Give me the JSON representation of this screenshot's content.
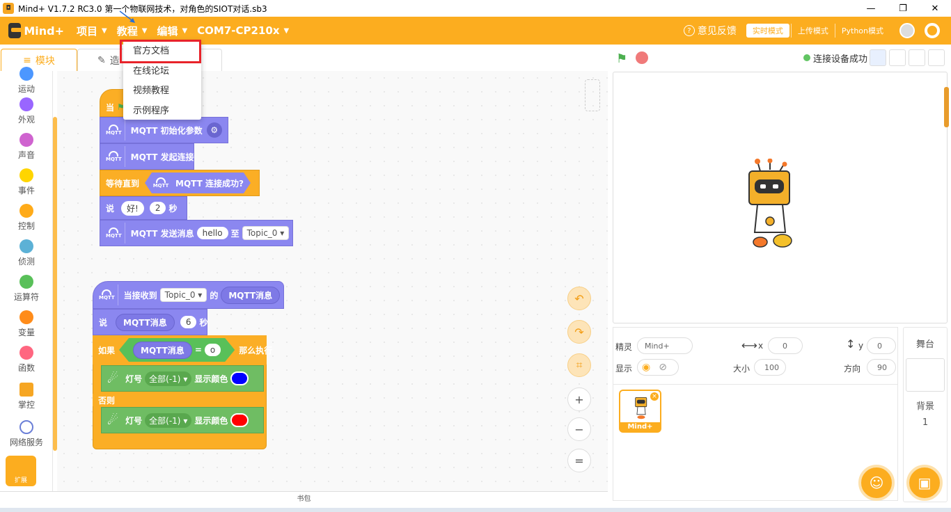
{
  "window": {
    "title": "Mind+ V1.7.2 RC3.0    第一个物联网技术，对角色的SIOT对话.sb3",
    "minimize": "—",
    "maximize": "❐",
    "close": "✕"
  },
  "menubar": {
    "logo": "Mind+",
    "menus": [
      {
        "label": "项目"
      },
      {
        "label": "教程"
      },
      {
        "label": "编辑"
      },
      {
        "label": "COM7-CP210x"
      }
    ],
    "feedback": "意见反馈",
    "modes": [
      "实时模式",
      "上传模式",
      "Python模式"
    ]
  },
  "dropdown": {
    "items": [
      "官方文档",
      "在线论坛",
      "视频教程",
      "示例程序"
    ]
  },
  "tabs": {
    "blocks": "模块",
    "code": "造"
  },
  "palette": {
    "categories": [
      {
        "label": "运动",
        "color": "#4c97ff"
      },
      {
        "label": "外观",
        "color": "#9966ff"
      },
      {
        "label": "声音",
        "color": "#cf63cf"
      },
      {
        "label": "事件",
        "color": "#ffd500"
      },
      {
        "label": "控制",
        "color": "#ffab19"
      },
      {
        "label": "侦测",
        "color": "#5cb1d6"
      },
      {
        "label": "运算符",
        "color": "#59c059"
      },
      {
        "label": "变量",
        "color": "#ff8c1a"
      },
      {
        "label": "函数",
        "color": "#ff6680"
      },
      {
        "label": "掌控",
        "color": "#f6a623"
      },
      {
        "label": "网络服务",
        "color": "#6b7fd7"
      }
    ],
    "extension": "扩展"
  },
  "script1": {
    "hat": "当",
    "init": "MQTT 初始化参数",
    "connect": "MQTT 发起连接",
    "wait_until": "等待直到",
    "connected": "MQTT 连接成功?",
    "say": "说",
    "say_text": "好!",
    "say_secs": "2",
    "secs_unit": "秒",
    "send": "MQTT 发送消息",
    "send_msg": "hello",
    "send_to": "至",
    "topic": "Topic_0"
  },
  "script2": {
    "on_receive": "当接收到",
    "topic": "Topic_0",
    "of": "的",
    "mqtt_msg": "MQTT消息",
    "say": "说",
    "say_secs": "6",
    "secs_unit": "秒",
    "if": "如果",
    "equals": "=",
    "compare_value": "o",
    "then": "那么执行",
    "else": "否则",
    "light": "灯号",
    "all": "全部(-1)",
    "show_color": "显示颜色",
    "color_then": "#0000ff",
    "color_else": "#ff0000"
  },
  "workspace_controls": {
    "undo": "↶",
    "redo": "↷",
    "crop": "⌗",
    "zoom_in": "+",
    "zoom_out": "−",
    "reset": "="
  },
  "stage_bar": {
    "connection": "连接设备成功"
  },
  "sprite_info": {
    "sprite_label": "精灵",
    "sprite_name": "Mind+",
    "x_label": "x",
    "x_value": "0",
    "y_label": "y",
    "y_value": "0",
    "show_label": "显示",
    "size_label": "大小",
    "size_value": "100",
    "direction_label": "方向",
    "direction_value": "90"
  },
  "sprite_card": {
    "name": "Mind+"
  },
  "stage_panel": {
    "stage": "舞台",
    "backdrop": "背景",
    "backdrop_count": "1"
  },
  "backpack": "书包"
}
